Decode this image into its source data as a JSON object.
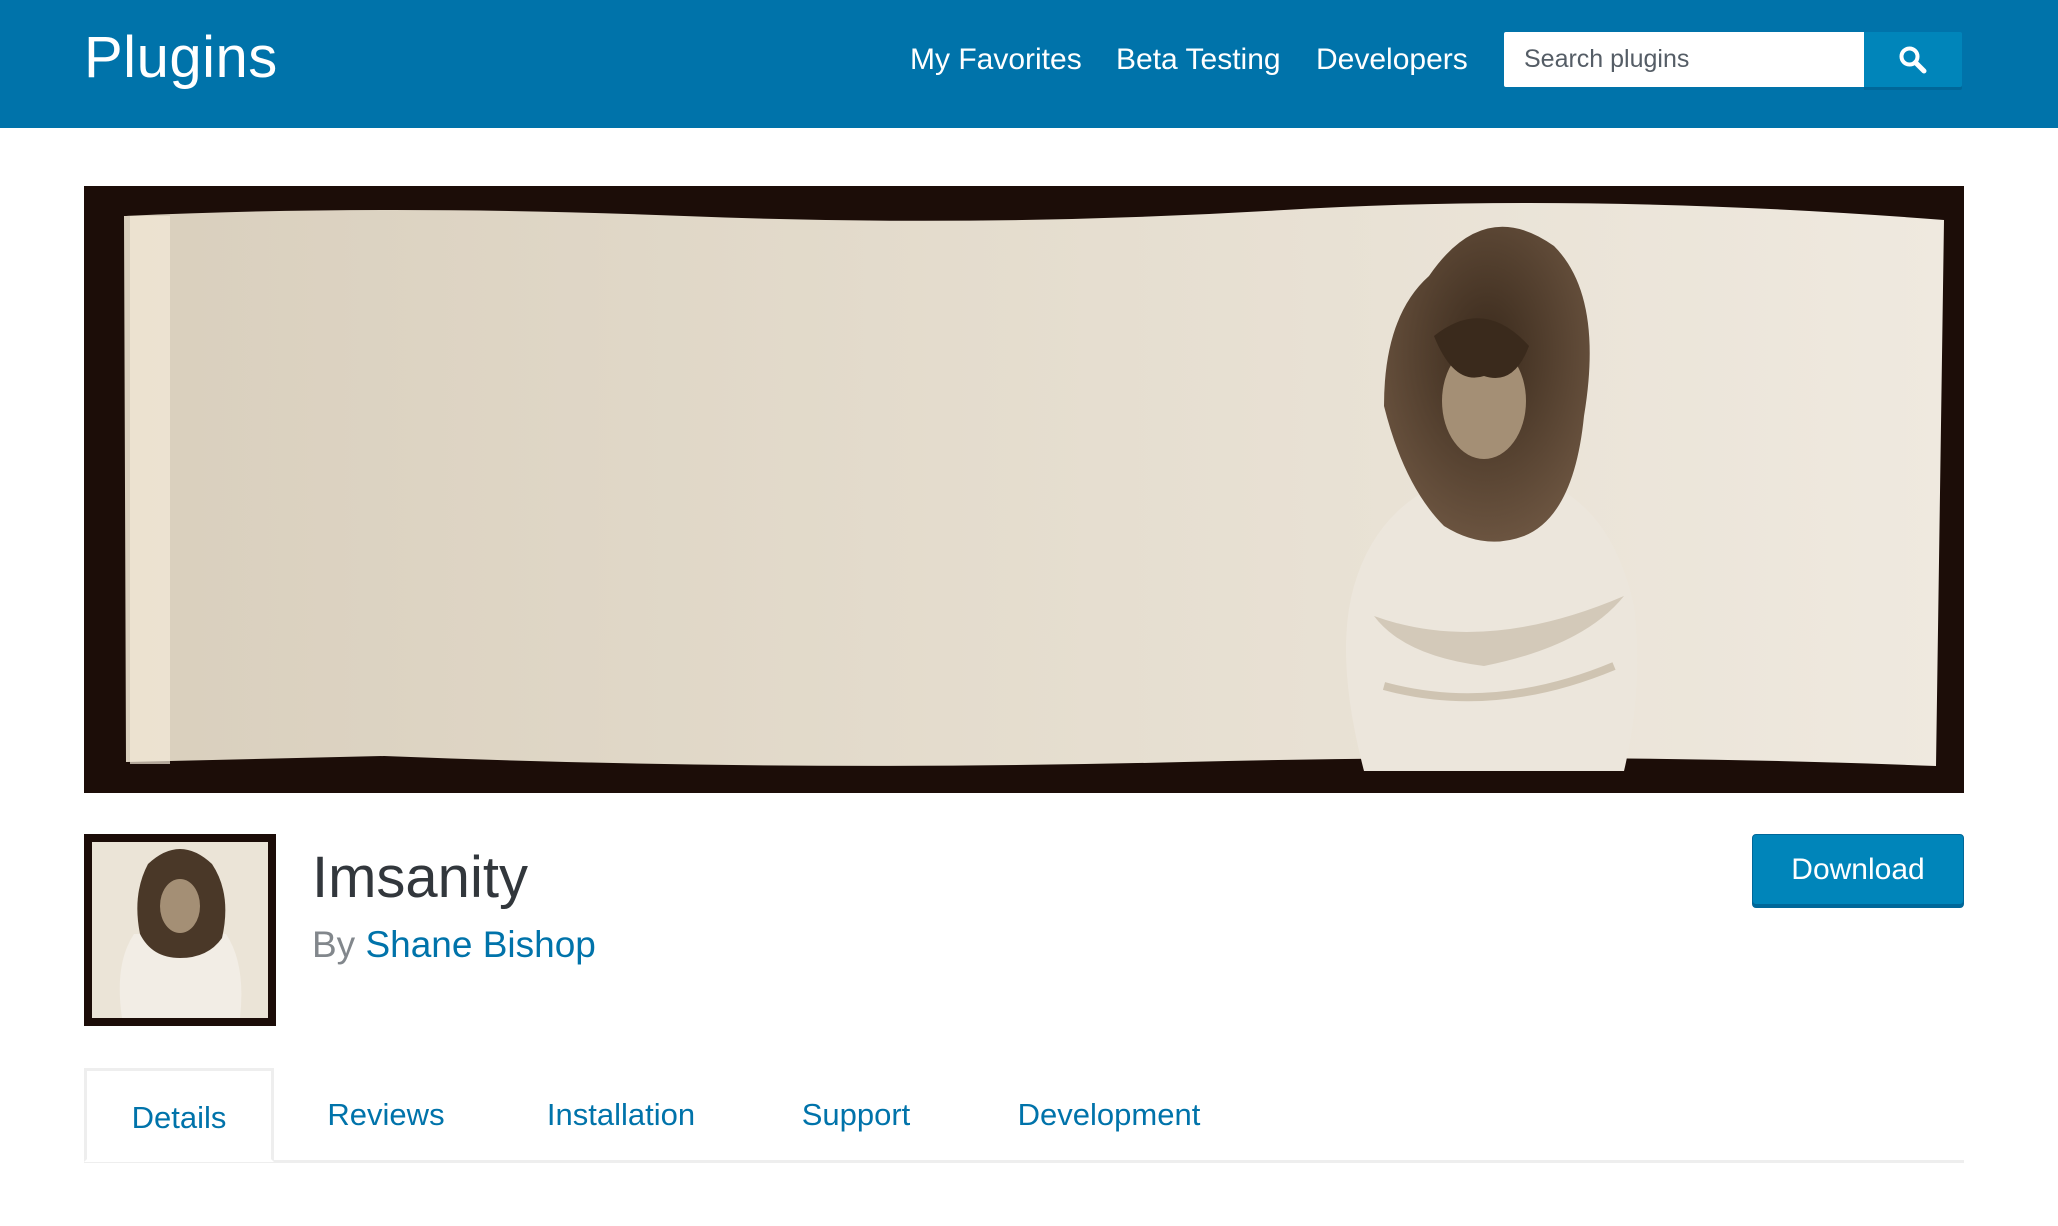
{
  "header": {
    "brand": "Plugins",
    "nav": [
      {
        "label": "My Favorites"
      },
      {
        "label": "Beta Testing"
      },
      {
        "label": "Developers"
      }
    ],
    "search": {
      "placeholder": "Search plugins",
      "value": "",
      "button_icon": "search-icon"
    }
  },
  "plugin": {
    "name": "Imsanity",
    "by_prefix": "By",
    "author": "Shane Bishop",
    "download_label": "Download"
  },
  "tabs": [
    {
      "label": "Details",
      "active": true
    },
    {
      "label": "Reviews",
      "active": false
    },
    {
      "label": "Installation",
      "active": false
    },
    {
      "label": "Support",
      "active": false
    },
    {
      "label": "Development",
      "active": false
    }
  ],
  "colors": {
    "header_bg": "#0073aa",
    "button_bg": "#0085ba",
    "link": "#0073aa",
    "text": "#32373c"
  }
}
